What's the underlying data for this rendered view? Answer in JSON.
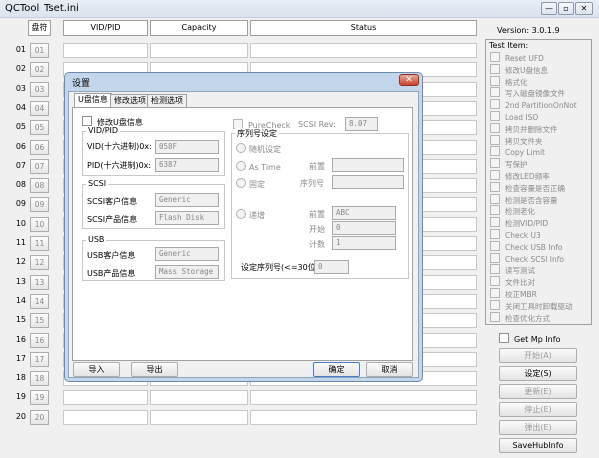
{
  "window": {
    "app_title": "QCTool",
    "file_title": "Tset.ini",
    "min_label": "—",
    "max_label": "▫",
    "close_label": "✕"
  },
  "headers": {
    "disk": "盘符",
    "vidpid": "VID/PID",
    "capacity": "Capacity",
    "status": "Status"
  },
  "rows": [
    "01",
    "02",
    "03",
    "04",
    "05",
    "06",
    "07",
    "08",
    "09",
    "10",
    "11",
    "12",
    "13",
    "14",
    "15",
    "16",
    "17",
    "18",
    "19",
    "20"
  ],
  "version": "Version: 3.0.1.9",
  "test_item": {
    "title": "Test Item:",
    "items": [
      "Reset UFD",
      "修改U盘信息",
      "格式化",
      "写入磁盘镜像文件",
      "2nd PartitionOnNot",
      "Load ISO",
      "拷贝并删除文件",
      "拷贝文件夹",
      "Copy Limit",
      "写保护",
      "修改LED频率",
      "检查容量是否正确",
      "检测是否含容量",
      "检测老化",
      "检测VID/PID",
      "Check U3",
      "Check USB Info",
      "Check SCSI Info",
      "读写测试",
      "文件比对",
      "校正MBR",
      "关闭工具时卸载驱动",
      "检查优化方式"
    ]
  },
  "get_mp_info": "Get Mp Info",
  "buttons": {
    "start": "开始(A)",
    "settings": "设定(S)",
    "update": "更新(E)",
    "stop": "停止(E)",
    "eject": "弹出(E)",
    "savehub": "SaveHubInfo"
  },
  "dialog": {
    "title": "设置",
    "close": "✕",
    "tabs": [
      "U盘信息",
      "修改选项",
      "检测选项"
    ],
    "modify_info": "修改U盘信息",
    "vidpid_group": "VID/PID",
    "vid_label": "VID(十六进制)0x:",
    "vid_value": "058F",
    "pid_label": "PID(十六进制)0x:",
    "pid_value": "6387",
    "scsi_group": "SCSI",
    "scsi_vendor_label": "SCSI客户信息",
    "scsi_vendor_value": "Generic",
    "scsi_product_label": "SCSI产品信息",
    "scsi_product_value": "Flash Disk",
    "usb_group": "USB",
    "usb_vendor_label": "USB客户信息",
    "usb_vendor_value": "Generic",
    "usb_product_label": "USB产品信息",
    "usb_product_value": "Mass Storage",
    "purecheck": "PureCheck",
    "scsi_rev_label": "SCSI Rev:",
    "scsi_rev_value": "8.07",
    "serial_group": "序列号设定",
    "random": "随机设定",
    "as_time": "As Time",
    "fixed": "固定",
    "increment": "递增",
    "prefix_label": "前置",
    "serial_label": "序列号",
    "prefix2_label": "前置",
    "prefix2_value": "ABC",
    "start_label": "开始",
    "start_value": "0",
    "count_label": "计数",
    "count_value": "1",
    "length_label": "设定序列号(<=30位)",
    "length_value": "0",
    "import": "导入",
    "export": "导出",
    "ok": "确定",
    "cancel": "取消"
  }
}
